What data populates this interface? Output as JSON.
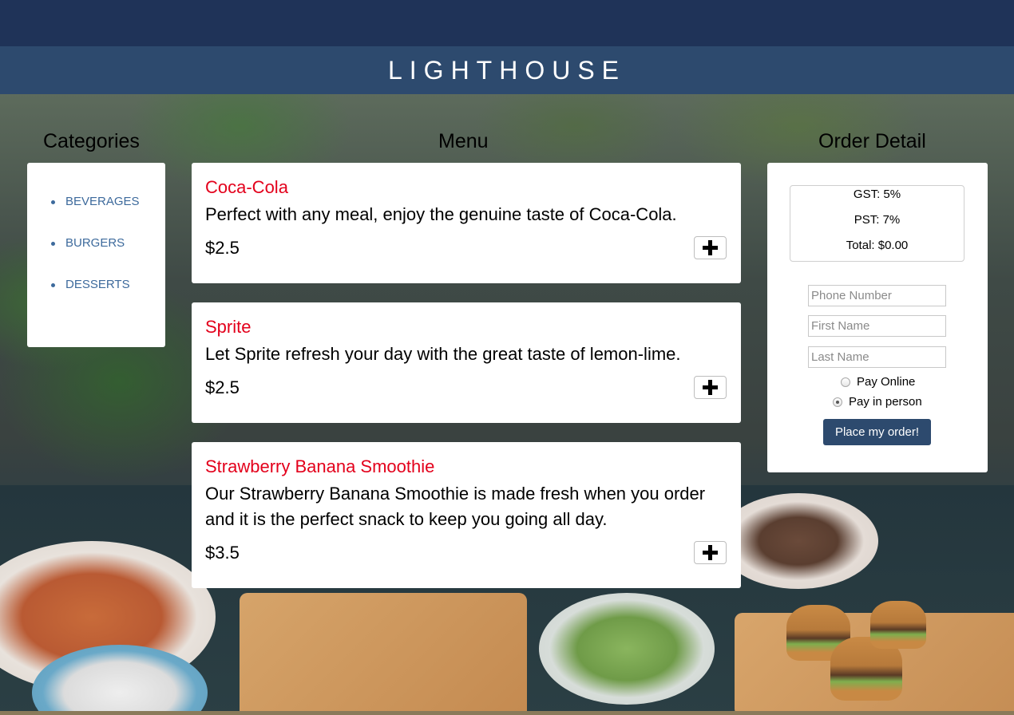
{
  "header": {
    "brand": "LIGHTHOUSE"
  },
  "columns": {
    "categories_title": "Categories",
    "menu_title": "Menu",
    "order_title": "Order Detail"
  },
  "categories": [
    {
      "label": "BEVERAGES"
    },
    {
      "label": "BURGERS"
    },
    {
      "label": "DESSERTS"
    }
  ],
  "menu": [
    {
      "name": "Coca-Cola",
      "description": "Perfect with any meal, enjoy the genuine taste of Coca-Cola.",
      "price": "$2.5",
      "add_icon": "plus-icon"
    },
    {
      "name": "Sprite",
      "description": "Let Sprite refresh your day with the great taste of lemon-lime.",
      "price": "$2.5",
      "add_icon": "plus-icon"
    },
    {
      "name": "Strawberry Banana Smoothie",
      "description": "Our Strawberry Banana Smoothie is made fresh when you order and it is the perfect snack to keep you going all day.",
      "price": "$3.5",
      "add_icon": "plus-icon"
    }
  ],
  "order": {
    "gst": "GST: 5%",
    "pst": "PST: 7%",
    "total": "Total: $0.00",
    "phone_placeholder": "Phone Number",
    "first_name_placeholder": "First Name",
    "last_name_placeholder": "Last Name",
    "pay_online": "Pay Online",
    "pay_in_person": "Pay in person",
    "selected_payment": "Pay in person",
    "place_order": "Place my order!"
  },
  "colors": {
    "topbar": "#1f3358",
    "header": "#2d4a6e",
    "item_name": "#e3001b",
    "category_link": "#3d6a9c",
    "button": "#2d4a6e"
  }
}
